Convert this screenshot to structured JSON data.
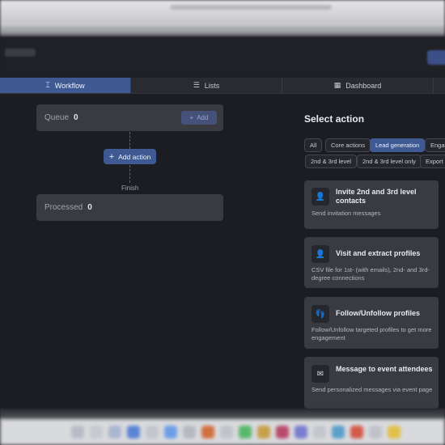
{
  "tabs": [
    {
      "label": "Workflow",
      "icon": "workflow-icon",
      "active": true
    },
    {
      "label": "Lists",
      "icon": "list-icon",
      "active": false
    },
    {
      "label": "Dashboard",
      "icon": "dashboard-icon",
      "active": false
    }
  ],
  "workflow": {
    "queue_label": "Queue",
    "queue_count": "0",
    "add_label": "Add",
    "add_action_label": "Add action",
    "finish_label": "Finish",
    "processed_label": "Processed",
    "processed_count": "0"
  },
  "panel": {
    "title": "Select action",
    "filters_row1": [
      "All",
      "Core actions",
      "Lead generation",
      "Engag"
    ],
    "filters_row2": [
      "2nd & 3rd level",
      "2nd & 3rd level only",
      "Export c"
    ],
    "active_filter": "Lead generation",
    "cards": [
      {
        "title": "Invite 2nd and 3rd level contacts",
        "desc": "Send invitation messages",
        "icon": "invite-icon"
      },
      {
        "title": "Visit and extract profiles",
        "desc": "CSV file for 1st- (with emails), 2nd- and 3rd-degree connections",
        "icon": "visit-profile-icon"
      },
      {
        "title": "Follow/Unfollow profiles",
        "desc": "Follow/Unfollow targeted profiles to get more engagement",
        "icon": "follow-icon"
      },
      {
        "title": "Message to event attendees",
        "desc": "Send personalized messages via event page",
        "icon": "event-message-icon"
      }
    ]
  },
  "colors": {
    "accent": "#3f5a93",
    "background": "#1c1d22",
    "card": "#3a3b41"
  }
}
